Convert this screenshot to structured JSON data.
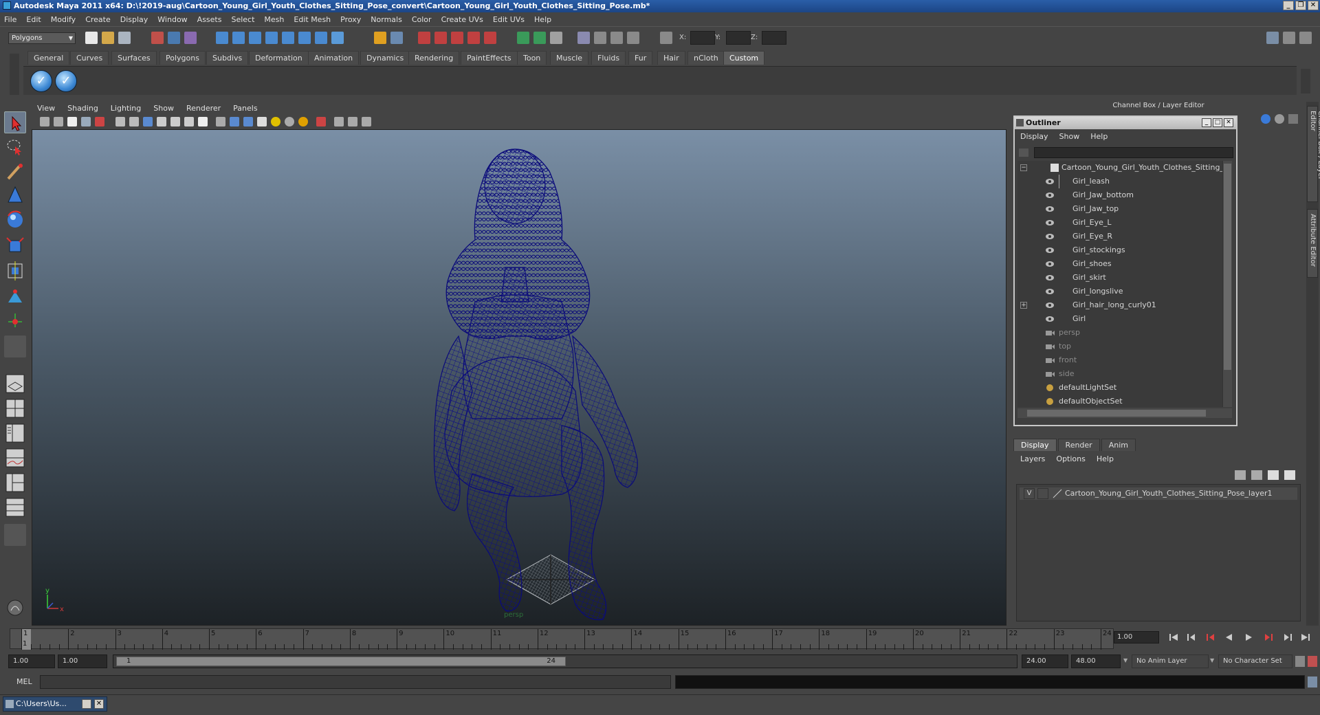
{
  "window": {
    "title": "Autodesk Maya 2011 x64: D:\\!2019-aug\\Cartoon_Young_Girl_Youth_Clothes_Sitting_Pose_convert\\Cartoon_Young_Girl_Youth_Clothes_Sitting_Pose.mb*"
  },
  "menubar": [
    "File",
    "Edit",
    "Modify",
    "Create",
    "Display",
    "Window",
    "Assets",
    "Select",
    "Mesh",
    "Edit Mesh",
    "Proxy",
    "Normals",
    "Color",
    "Create UVs",
    "Edit UVs",
    "Help"
  ],
  "status_line": {
    "mode": "Polygons",
    "x_label": "X:",
    "y_label": "Y:",
    "z_label": "Z:"
  },
  "shelf": {
    "tabs": [
      "General",
      "Curves",
      "Surfaces",
      "Polygons",
      "Subdivs",
      "Deformation",
      "Animation",
      "Dynamics",
      "Rendering",
      "PaintEffects",
      "Toon",
      "Muscle",
      "Fluids",
      "Fur",
      "Hair",
      "nCloth",
      "Custom"
    ],
    "active_tab": "Custom"
  },
  "viewport": {
    "menu": [
      "View",
      "Shading",
      "Lighting",
      "Show",
      "Renderer",
      "Panels"
    ],
    "camera": "persp",
    "axis_y": "y",
    "axis_x": "x",
    "wire_color": "#0a0a7a"
  },
  "right_panel": {
    "header": "Channel Box / Layer Editor"
  },
  "outliner": {
    "title": "Outliner",
    "menu": [
      "Display",
      "Show",
      "Help"
    ],
    "root": "Cartoon_Young_Girl_Youth_Clothes_Sitting_Pos",
    "children": [
      "Girl_leash",
      "Girl_Jaw_bottom",
      "Girl_Jaw_top",
      "Girl_Eye_L",
      "Girl_Eye_R",
      "Girl_stockings",
      "Girl_shoes",
      "Girl_skirt",
      "Girl_longslive",
      "Girl_hair_long_curly01",
      "Girl"
    ],
    "cameras": [
      "persp",
      "top",
      "front",
      "side"
    ],
    "sets": [
      "defaultLightSet",
      "defaultObjectSet"
    ]
  },
  "layer_editor": {
    "tabs": [
      "Display",
      "Render",
      "Anim"
    ],
    "active_tab": "Display",
    "menu": [
      "Layers",
      "Options",
      "Help"
    ],
    "layers": [
      {
        "visible": "V",
        "name": "Cartoon_Young_Girl_Youth_Clothes_Sitting_Pose_layer1"
      }
    ]
  },
  "side_tabs": [
    "Channel Box / Layer Editor",
    "Attribute Editor"
  ],
  "time_slider": {
    "ticks": [
      "1",
      "2",
      "3",
      "4",
      "5",
      "6",
      "7",
      "8",
      "9",
      "10",
      "11",
      "12",
      "13",
      "14",
      "15",
      "16",
      "17",
      "18",
      "19",
      "20",
      "21",
      "22",
      "23",
      "24"
    ],
    "current_frame_marker": "1",
    "current_frame": "1.00"
  },
  "range_slider": {
    "start": "1.00",
    "anim_start": "1.00",
    "range_start": "1",
    "range_end": "24",
    "anim_end": "24.00",
    "end": "48.00",
    "anim_layer": "No Anim Layer",
    "character_set": "No Character Set"
  },
  "command_line": {
    "label": "MEL"
  },
  "taskbar": {
    "item": "C:\\Users\\Us..."
  }
}
